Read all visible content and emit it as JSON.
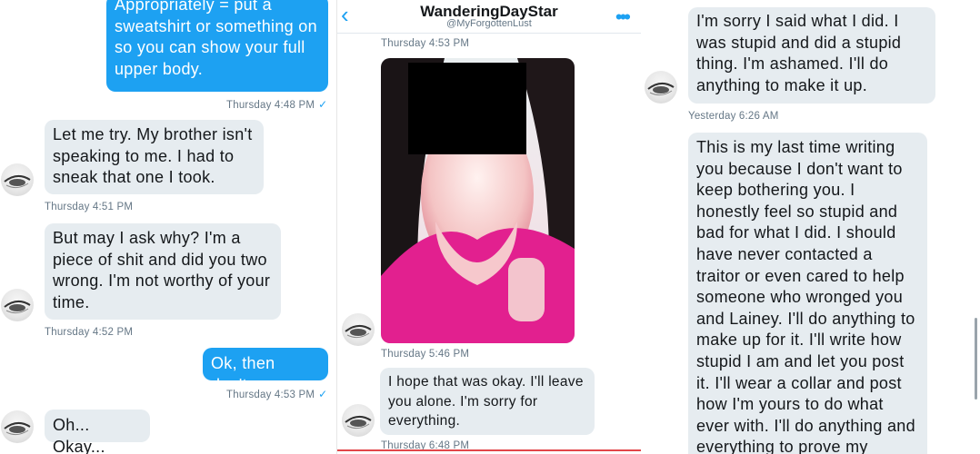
{
  "left_chat": {
    "out_msg_1": "Appropriately = put a sweatshirt or something on so you can show your full upper body.",
    "ts_1": "Thursday 4:48 PM",
    "in_msg_1": "Let me try. My brother isn't speaking to me. I had to sneak that one I took.",
    "ts_2": "Thursday 4:51 PM",
    "in_msg_2": "But may I ask why? I'm a piece of shit and did you two wrong. I'm not worthy of your time.",
    "ts_3": "Thursday 4:52 PM",
    "out_msg_2": "Ok, then don't.",
    "ts_4": "Thursday 4:53 PM",
    "in_msg_3": "Oh... Okay...",
    "check": "✓"
  },
  "middle_chat": {
    "header": {
      "name": "WanderingDayStar",
      "handle": "@MyForgottenLust",
      "back_glyph": "‹",
      "more_glyph": "•••"
    },
    "ts_1": "Thursday 4:53 PM",
    "ts_2": "Thursday 5:46 PM",
    "in_msg_1": "I hope that was okay. I'll leave you alone. I'm sorry for everything.",
    "ts_3": "Thursday 6:48 PM"
  },
  "right_chat": {
    "in_msg_1": "I'm sorry I said what I did. I was stupid and did a stupid thing. I'm ashamed. I'll do anything to make it up.",
    "ts_1": "Yesterday 6:26 AM",
    "in_msg_2": "This is my last time writing you because I don't want to keep bothering you. I honestly feel so stupid and bad for what I did. I should have never contacted a traitor or even cared to help someone who wronged you and Lainey. I'll do anything to make up for it. I'll write how stupid I am and let you post it. I'll wear a collar and post how I'm yours to do what ever with. I'll do anything and everything to prove my"
  },
  "colors": {
    "outgoing_bubble": "#1da1f2",
    "incoming_bubble": "#e6ecf0",
    "timestamp": "#657786",
    "accent": "#1da1f2"
  },
  "icons": [
    "back-chevron-icon",
    "more-dots-icon",
    "avatar-eye-icon",
    "read-check-icon"
  ]
}
